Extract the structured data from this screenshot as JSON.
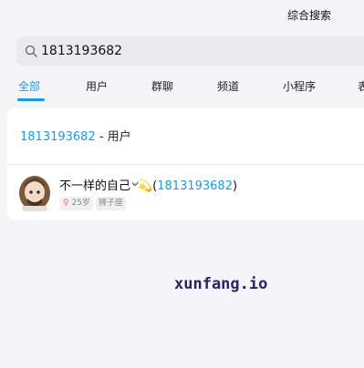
{
  "header": {
    "title": "综合搜索"
  },
  "search": {
    "query": "1813193682"
  },
  "tabs": [
    {
      "label": "全部",
      "active": true
    },
    {
      "label": "用户"
    },
    {
      "label": "群聊"
    },
    {
      "label": "频道"
    },
    {
      "label": "小程序"
    },
    {
      "label": "表"
    }
  ],
  "section": {
    "keyword": "1813193682",
    "suffix": " - 用户"
  },
  "result": {
    "name_prefix": "不一样的自己",
    "name_emoji": "৺💫",
    "name_open": "(",
    "name_id": "1813193682",
    "name_close": ")",
    "gender_icon": "♀",
    "age": "25岁",
    "zodiac": "狮子座"
  },
  "watermark": "xunfang.io",
  "colors": {
    "accent": "#1a9bdb",
    "background": "#f5f5f7",
    "card": "#ffffff"
  }
}
